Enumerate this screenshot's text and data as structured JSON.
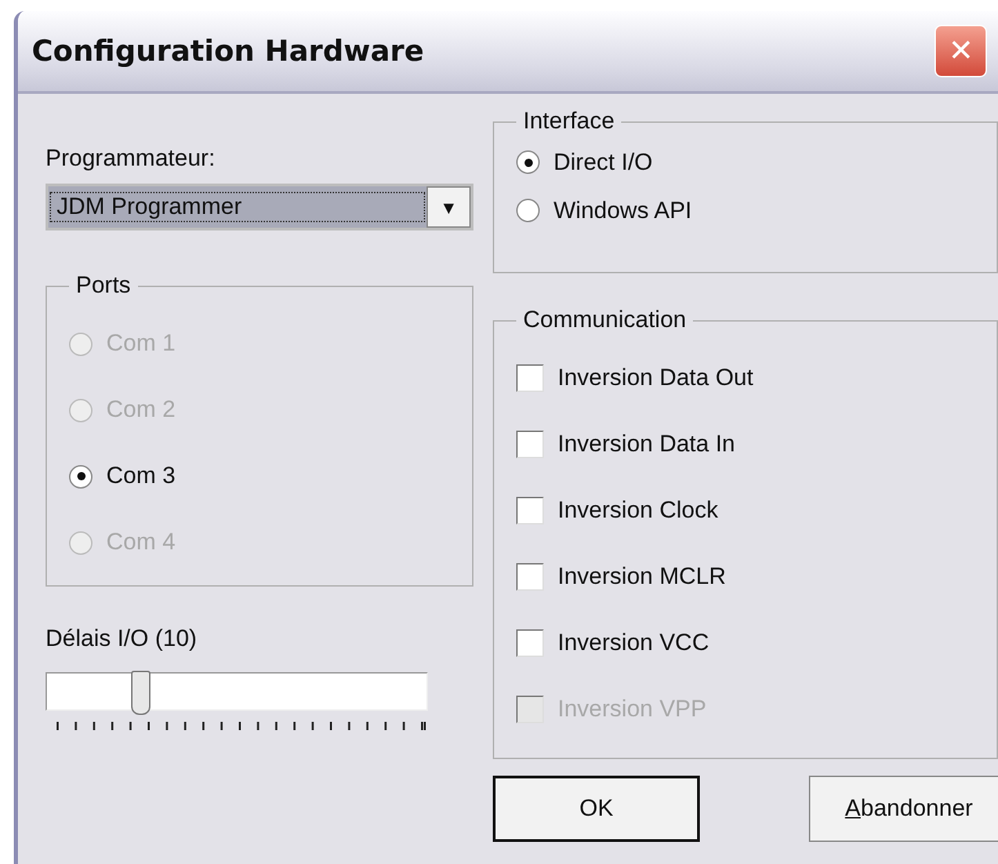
{
  "window": {
    "title": "Configuration Hardware",
    "close": "✕"
  },
  "programmer": {
    "label": "Programmateur:",
    "value": "JDM Programmer",
    "arrow": "▼"
  },
  "interface": {
    "title": "Interface",
    "options": [
      {
        "label": "Direct I/O",
        "selected": true,
        "disabled": false
      },
      {
        "label": "Windows API",
        "selected": false,
        "disabled": false
      }
    ]
  },
  "ports": {
    "title": "Ports",
    "options": [
      {
        "label": "Com 1",
        "selected": false,
        "disabled": true
      },
      {
        "label": "Com 2",
        "selected": false,
        "disabled": true
      },
      {
        "label": "Com 3",
        "selected": true,
        "disabled": false
      },
      {
        "label": "Com 4",
        "selected": false,
        "disabled": true
      }
    ]
  },
  "delay": {
    "label": "Délais I/O  (10)",
    "level": 0.25
  },
  "communication": {
    "title": "Communication",
    "options": [
      {
        "label": "Inversion Data Out",
        "checked": false,
        "disabled": false
      },
      {
        "label": "Inversion Data In",
        "checked": false,
        "disabled": false
      },
      {
        "label": "Inversion Clock",
        "checked": false,
        "disabled": false
      },
      {
        "label": "Inversion MCLR",
        "checked": false,
        "disabled": false
      },
      {
        "label": "Inversion VCC",
        "checked": false,
        "disabled": false
      },
      {
        "label": "Inversion VPP",
        "checked": false,
        "disabled": true
      }
    ]
  },
  "buttons": [
    {
      "label": "OK",
      "default": true
    },
    {
      "label": "Abandonner",
      "default": false
    }
  ]
}
